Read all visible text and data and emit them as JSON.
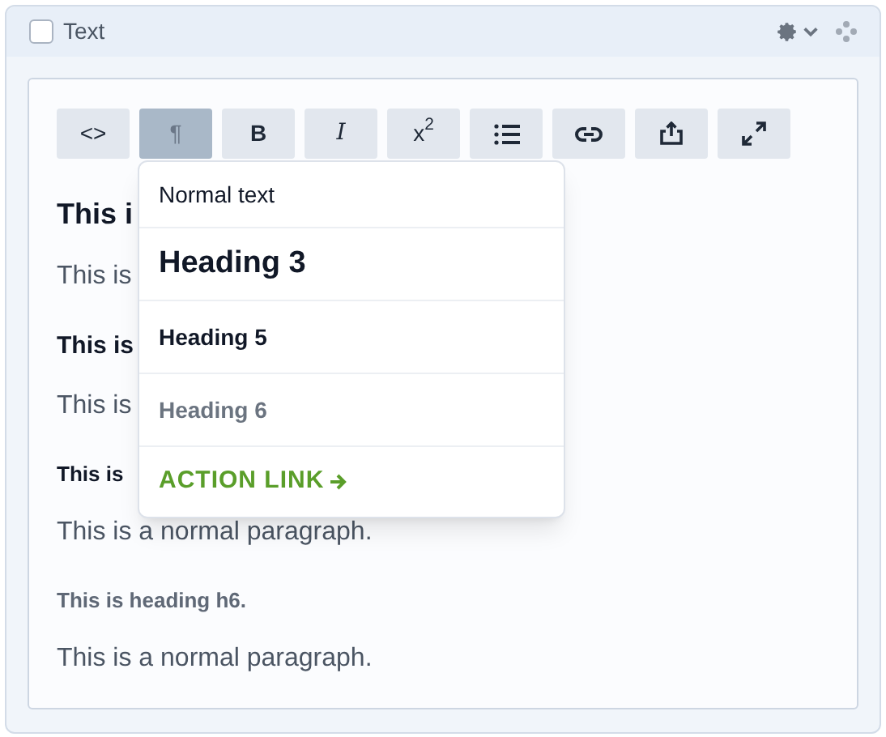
{
  "panel": {
    "title": "Text",
    "checked": false
  },
  "toolbar": [
    {
      "kind": "text",
      "label": "<>",
      "selected": false
    },
    {
      "kind": "text",
      "label": "¶",
      "selected": true
    },
    {
      "kind": "bold",
      "label": "B",
      "selected": false
    },
    {
      "kind": "italic",
      "label": "I",
      "selected": false
    },
    {
      "kind": "text",
      "label": "x$^{2}$",
      "selected": false
    },
    {
      "kind": "list",
      "selected": false
    },
    {
      "kind": "link",
      "selected": false
    },
    {
      "kind": "upload",
      "selected": false
    },
    {
      "kind": "expand",
      "selected": false
    }
  ],
  "content": [
    {
      "kind": "h3",
      "text": "This i"
    },
    {
      "kind": "p",
      "text": "This is"
    },
    {
      "kind": "h5",
      "text": "This is"
    },
    {
      "kind": "p",
      "text": "This is"
    },
    {
      "kind": "h5s",
      "text": "This is"
    },
    {
      "kind": "p",
      "text": "This is a normal paragraph."
    },
    {
      "kind": "h6",
      "text": "This is heading h6."
    },
    {
      "kind": "p",
      "text": "This is a normal paragraph."
    }
  ],
  "dropdown": [
    {
      "kind": "normal",
      "label": "Normal text"
    },
    {
      "kind": "h3",
      "label": "Heading 3"
    },
    {
      "kind": "h5",
      "label": "Heading 5"
    },
    {
      "kind": "h6",
      "label": "Heading 6"
    },
    {
      "kind": "action",
      "label": "ACTION LINK"
    }
  ]
}
